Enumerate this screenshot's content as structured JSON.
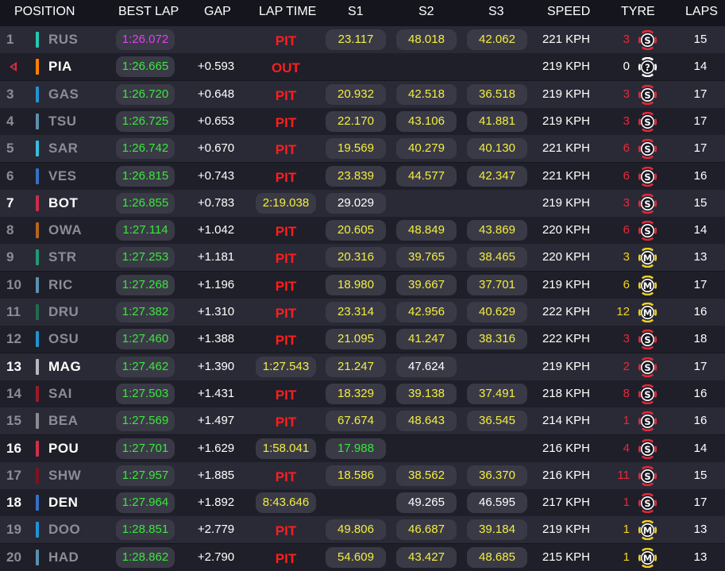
{
  "header": {
    "position": "POSITION",
    "best_lap": "BEST LAP",
    "gap": "GAP",
    "lap_time": "LAP TIME",
    "s1": "S1",
    "s2": "S2",
    "s3": "S3",
    "speed": "SPEED",
    "tyre": "TYRE",
    "laps": "LAPS"
  },
  "colors": {
    "red_tyre": "#e8283a",
    "yellow_tyre": "#f2d21e",
    "white_tyre": "#ffffff",
    "purple": "#e040f0",
    "green": "#38e838",
    "yellow": "#f2ee40",
    "pit_red": "#ff1e1e"
  },
  "rows": [
    {
      "pos": "1",
      "arrow": false,
      "code": "RUS",
      "team_color": "#27c7b0",
      "bright": false,
      "best": "1:26.072",
      "best_purple": true,
      "gap": "",
      "lap_type": "pit",
      "lap": "PIT",
      "s1": "23.117",
      "s1c": "yellow",
      "s2": "48.018",
      "s2c": "yellow",
      "s3": "42.062",
      "s3c": "yellow",
      "speed": "221 KPH",
      "tyre_age": "3",
      "tyre_age_color": "#e8283a",
      "tyre_letter": "S",
      "tyre_color": "#e8283a",
      "laps": "15"
    },
    {
      "pos": "",
      "arrow": true,
      "code": "PIA",
      "team_color": "#ff8000",
      "bright": true,
      "best": "1:26.665",
      "best_purple": false,
      "gap": "+0.593",
      "lap_type": "pit",
      "lap": "OUT",
      "s1": "",
      "s1c": "",
      "s2": "",
      "s2c": "",
      "s3": "",
      "s3c": "",
      "speed": "219 KPH",
      "tyre_age": "0",
      "tyre_age_color": "#ffffff",
      "tyre_letter": "?",
      "tyre_color": "#ffffff",
      "laps": "14"
    },
    {
      "pos": "3",
      "arrow": false,
      "code": "GAS",
      "team_color": "#2293d1",
      "bright": false,
      "best": "1:26.720",
      "best_purple": false,
      "gap": "+0.648",
      "lap_type": "pit",
      "lap": "PIT",
      "s1": "20.932",
      "s1c": "yellow",
      "s2": "42.518",
      "s2c": "yellow",
      "s3": "36.518",
      "s3c": "yellow",
      "speed": "219 KPH",
      "tyre_age": "3",
      "tyre_age_color": "#e8283a",
      "tyre_letter": "S",
      "tyre_color": "#e8283a",
      "laps": "17"
    },
    {
      "pos": "4",
      "arrow": false,
      "code": "TSU",
      "team_color": "#5e8faa",
      "bright": false,
      "best": "1:26.725",
      "best_purple": false,
      "gap": "+0.653",
      "lap_type": "pit",
      "lap": "PIT",
      "s1": "22.170",
      "s1c": "yellow",
      "s2": "43.106",
      "s2c": "yellow",
      "s3": "41.881",
      "s3c": "yellow",
      "speed": "219 KPH",
      "tyre_age": "3",
      "tyre_age_color": "#e8283a",
      "tyre_letter": "S",
      "tyre_color": "#e8283a",
      "laps": "17"
    },
    {
      "pos": "5",
      "arrow": false,
      "code": "SAR",
      "team_color": "#37bedd",
      "bright": false,
      "best": "1:26.742",
      "best_purple": false,
      "gap": "+0.670",
      "lap_type": "pit",
      "lap": "PIT",
      "s1": "19.569",
      "s1c": "yellow",
      "s2": "40.279",
      "s2c": "yellow",
      "s3": "40.130",
      "s3c": "yellow",
      "speed": "221 KPH",
      "tyre_age": "6",
      "tyre_age_color": "#e8283a",
      "tyre_letter": "S",
      "tyre_color": "#e8283a",
      "laps": "17"
    },
    {
      "pos": "6",
      "arrow": false,
      "code": "VES",
      "team_color": "#3671c6",
      "bright": false,
      "best": "1:26.815",
      "best_purple": false,
      "gap": "+0.743",
      "lap_type": "pit",
      "lap": "PIT",
      "s1": "23.839",
      "s1c": "yellow",
      "s2": "44.577",
      "s2c": "yellow",
      "s3": "42.347",
      "s3c": "yellow",
      "speed": "221 KPH",
      "tyre_age": "6",
      "tyre_age_color": "#e8283a",
      "tyre_letter": "S",
      "tyre_color": "#e8283a",
      "laps": "16"
    },
    {
      "pos": "7",
      "arrow": false,
      "code": "BOT",
      "team_color": "#c92d4b",
      "bright": true,
      "best": "1:26.855",
      "best_purple": false,
      "gap": "+0.783",
      "lap_type": "time",
      "lap": "2:19.038",
      "s1": "29.029",
      "s1c": "white",
      "s2": "",
      "s2c": "",
      "s3": "",
      "s3c": "",
      "speed": "219 KPH",
      "tyre_age": "3",
      "tyre_age_color": "#e8283a",
      "tyre_letter": "S",
      "tyre_color": "#e8283a",
      "laps": "15"
    },
    {
      "pos": "8",
      "arrow": false,
      "code": "OWA",
      "team_color": "#b6651b",
      "bright": false,
      "best": "1:27.114",
      "best_purple": false,
      "gap": "+1.042",
      "lap_type": "pit",
      "lap": "PIT",
      "s1": "20.605",
      "s1c": "yellow",
      "s2": "48.849",
      "s2c": "yellow",
      "s3": "43.869",
      "s3c": "yellow",
      "speed": "220 KPH",
      "tyre_age": "6",
      "tyre_age_color": "#e8283a",
      "tyre_letter": "S",
      "tyre_color": "#e8283a",
      "laps": "14"
    },
    {
      "pos": "9",
      "arrow": false,
      "code": "STR",
      "team_color": "#229971",
      "bright": false,
      "best": "1:27.253",
      "best_purple": false,
      "gap": "+1.181",
      "lap_type": "pit",
      "lap": "PIT",
      "s1": "20.316",
      "s1c": "yellow",
      "s2": "39.765",
      "s2c": "yellow",
      "s3": "38.465",
      "s3c": "yellow",
      "speed": "220 KPH",
      "tyre_age": "3",
      "tyre_age_color": "#f2d21e",
      "tyre_letter": "M",
      "tyre_color": "#f2d21e",
      "laps": "13"
    },
    {
      "pos": "10",
      "arrow": false,
      "code": "RIC",
      "team_color": "#5e8faa",
      "bright": false,
      "best": "1:27.268",
      "best_purple": false,
      "gap": "+1.196",
      "lap_type": "pit",
      "lap": "PIT",
      "s1": "18.980",
      "s1c": "yellow",
      "s2": "39.667",
      "s2c": "yellow",
      "s3": "37.701",
      "s3c": "yellow",
      "speed": "219 KPH",
      "tyre_age": "6",
      "tyre_age_color": "#f2d21e",
      "tyre_letter": "M",
      "tyre_color": "#f2d21e",
      "laps": "17"
    },
    {
      "pos": "11",
      "arrow": false,
      "code": "DRU",
      "team_color": "#1f6b4f",
      "bright": false,
      "best": "1:27.382",
      "best_purple": false,
      "gap": "+1.310",
      "lap_type": "pit",
      "lap": "PIT",
      "s1": "23.314",
      "s1c": "yellow",
      "s2": "42.956",
      "s2c": "yellow",
      "s3": "40.629",
      "s3c": "yellow",
      "speed": "222 KPH",
      "tyre_age": "12",
      "tyre_age_color": "#f2d21e",
      "tyre_letter": "M",
      "tyre_color": "#f2d21e",
      "laps": "16"
    },
    {
      "pos": "12",
      "arrow": false,
      "code": "OSU",
      "team_color": "#2293d1",
      "bright": false,
      "best": "1:27.460",
      "best_purple": false,
      "gap": "+1.388",
      "lap_type": "pit",
      "lap": "PIT",
      "s1": "21.095",
      "s1c": "yellow",
      "s2": "41.247",
      "s2c": "yellow",
      "s3": "38.316",
      "s3c": "yellow",
      "speed": "222 KPH",
      "tyre_age": "3",
      "tyre_age_color": "#e8283a",
      "tyre_letter": "S",
      "tyre_color": "#e8283a",
      "laps": "18"
    },
    {
      "pos": "13",
      "arrow": false,
      "code": "MAG",
      "team_color": "#b6babd",
      "bright": true,
      "best": "1:27.462",
      "best_purple": false,
      "gap": "+1.390",
      "lap_type": "time",
      "lap": "1:27.543",
      "s1": "21.247",
      "s1c": "yellow",
      "s2": "47.624",
      "s2c": "white",
      "s3": "",
      "s3c": "",
      "speed": "219 KPH",
      "tyre_age": "2",
      "tyre_age_color": "#e8283a",
      "tyre_letter": "S",
      "tyre_color": "#e8283a",
      "laps": "17"
    },
    {
      "pos": "14",
      "arrow": false,
      "code": "SAI",
      "team_color": "#9a1a2a",
      "bright": false,
      "best": "1:27.503",
      "best_purple": false,
      "gap": "+1.431",
      "lap_type": "pit",
      "lap": "PIT",
      "s1": "18.329",
      "s1c": "yellow",
      "s2": "39.138",
      "s2c": "yellow",
      "s3": "37.491",
      "s3c": "yellow",
      "speed": "218 KPH",
      "tyre_age": "8",
      "tyre_age_color": "#e8283a",
      "tyre_letter": "S",
      "tyre_color": "#e8283a",
      "laps": "16"
    },
    {
      "pos": "15",
      "arrow": false,
      "code": "BEA",
      "team_color": "#8a8d90",
      "bright": false,
      "best": "1:27.569",
      "best_purple": false,
      "gap": "+1.497",
      "lap_type": "pit",
      "lap": "PIT",
      "s1": "67.674",
      "s1c": "yellow",
      "s2": "48.643",
      "s2c": "yellow",
      "s3": "36.545",
      "s3c": "yellow",
      "speed": "214 KPH",
      "tyre_age": "1",
      "tyre_age_color": "#e8283a",
      "tyre_letter": "S",
      "tyre_color": "#e8283a",
      "laps": "16"
    },
    {
      "pos": "16",
      "arrow": false,
      "code": "POU",
      "team_color": "#d0304a",
      "bright": true,
      "best": "1:27.701",
      "best_purple": false,
      "gap": "+1.629",
      "lap_type": "time",
      "lap": "1:58.041",
      "s1": "17.988",
      "s1c": "green",
      "s2": "",
      "s2c": "",
      "s3": "",
      "s3c": "",
      "speed": "216 KPH",
      "tyre_age": "4",
      "tyre_age_color": "#e8283a",
      "tyre_letter": "S",
      "tyre_color": "#e8283a",
      "laps": "14"
    },
    {
      "pos": "17",
      "arrow": false,
      "code": "SHW",
      "team_color": "#7a1520",
      "bright": false,
      "best": "1:27.957",
      "best_purple": false,
      "gap": "+1.885",
      "lap_type": "pit",
      "lap": "PIT",
      "s1": "18.586",
      "s1c": "yellow",
      "s2": "38.562",
      "s2c": "yellow",
      "s3": "36.370",
      "s3c": "yellow",
      "speed": "216 KPH",
      "tyre_age": "11",
      "tyre_age_color": "#e8283a",
      "tyre_letter": "S",
      "tyre_color": "#e8283a",
      "laps": "15"
    },
    {
      "pos": "18",
      "arrow": false,
      "code": "DEN",
      "team_color": "#3671c6",
      "bright": true,
      "best": "1:27.964",
      "best_purple": false,
      "gap": "+1.892",
      "lap_type": "time",
      "lap": "8:43.646",
      "s1": "",
      "s1c": "",
      "s2": "49.265",
      "s2c": "white",
      "s3": "46.595",
      "s3c": "white",
      "speed": "217 KPH",
      "tyre_age": "1",
      "tyre_age_color": "#e8283a",
      "tyre_letter": "S",
      "tyre_color": "#e8283a",
      "laps": "17"
    },
    {
      "pos": "19",
      "arrow": false,
      "code": "DOO",
      "team_color": "#2293d1",
      "bright": false,
      "best": "1:28.851",
      "best_purple": false,
      "gap": "+2.779",
      "lap_type": "pit",
      "lap": "PIT",
      "s1": "49.806",
      "s1c": "yellow",
      "s2": "46.687",
      "s2c": "yellow",
      "s3": "39.184",
      "s3c": "yellow",
      "speed": "219 KPH",
      "tyre_age": "1",
      "tyre_age_color": "#f2d21e",
      "tyre_letter": "M",
      "tyre_color": "#f2d21e",
      "laps": "13"
    },
    {
      "pos": "20",
      "arrow": false,
      "code": "HAD",
      "team_color": "#5e8faa",
      "bright": false,
      "best": "1:28.862",
      "best_purple": false,
      "gap": "+2.790",
      "lap_type": "pit",
      "lap": "PIT",
      "s1": "54.609",
      "s1c": "yellow",
      "s2": "43.427",
      "s2c": "yellow",
      "s3": "48.685",
      "s3c": "yellow",
      "speed": "215 KPH",
      "tyre_age": "1",
      "tyre_age_color": "#f2d21e",
      "tyre_letter": "M",
      "tyre_color": "#f2d21e",
      "laps": "13"
    }
  ]
}
